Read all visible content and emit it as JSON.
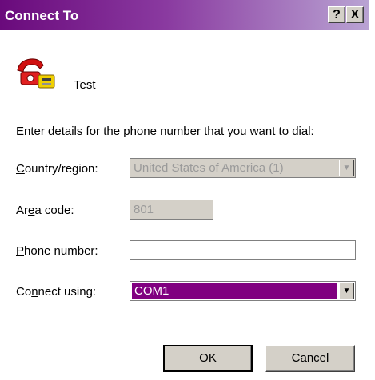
{
  "window": {
    "title": "Connect To",
    "help_glyph": "?",
    "close_glyph": "X"
  },
  "connection": {
    "name": "Test",
    "icon": "phone-connection-icon"
  },
  "instruction": "Enter details for the phone number that you want to dial:",
  "fields": {
    "country": {
      "label_pre": "",
      "label_accel": "C",
      "label_post": "ountry/region:",
      "value": "United States of America (1)",
      "enabled": false
    },
    "area_code": {
      "label_pre": "Ar",
      "label_accel": "e",
      "label_post": "a code:",
      "value": "801",
      "enabled": false
    },
    "phone_number": {
      "label_pre": "",
      "label_accel": "P",
      "label_post": "hone number:",
      "value": "",
      "enabled": true
    },
    "connect_using": {
      "label_pre": "Co",
      "label_accel": "n",
      "label_post": "nect using:",
      "value": "COM1",
      "enabled": true
    }
  },
  "buttons": {
    "ok": "OK",
    "cancel": "Cancel"
  },
  "colors": {
    "title_start": "#6a0a7c",
    "selection": "#800080",
    "face": "#d4d0c8"
  }
}
